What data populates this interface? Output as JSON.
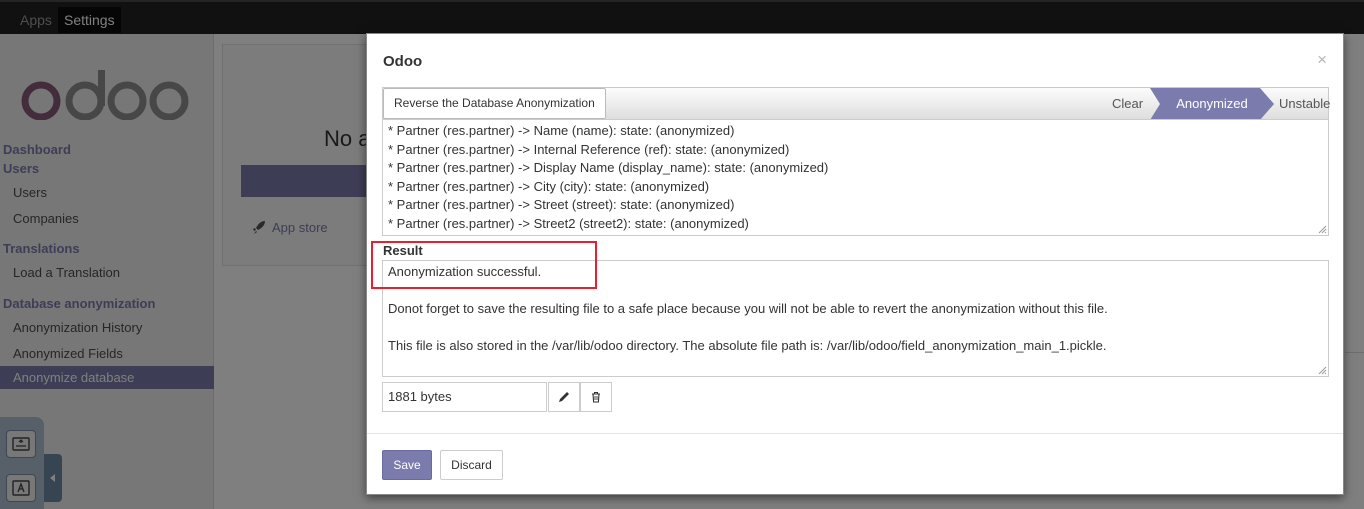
{
  "topnav": {
    "apps": "Apps",
    "settings": "Settings"
  },
  "sidebar": {
    "logo_text": "odoo",
    "sections": [
      {
        "head": "Dashboard"
      },
      {
        "head": "Users",
        "items": [
          "Users",
          "Companies"
        ]
      },
      {
        "head": "Translations",
        "items": [
          "Load a Translation"
        ]
      },
      {
        "head": "Database anonymization",
        "items": [
          "Anonymization History",
          "Anonymized Fields",
          "Anonymize database"
        ]
      }
    ],
    "active_item": "Anonymize database"
  },
  "main": {
    "title_fragment": "No a",
    "app_store": "App store"
  },
  "modal": {
    "title": "Odoo",
    "close": "×",
    "reverse_button": "Reverse the Database Anonymization",
    "states": {
      "clear": "Clear",
      "anonymized": "Anonymized",
      "unstable": "Unstable"
    },
    "active_state": "Anonymized",
    "fields_lines": [
      "* Partner (res.partner) -> Name (name): state: (anonymized)",
      "* Partner (res.partner) -> Internal Reference (ref): state: (anonymized)",
      "* Partner (res.partner) -> Display Name (display_name): state: (anonymized)",
      "* Partner (res.partner) -> City (city): state: (anonymized)",
      "* Partner (res.partner) -> Street (street): state: (anonymized)",
      "* Partner (res.partner) -> Street2 (street2): state: (anonymized)"
    ],
    "result_label": "Result",
    "result_lines": [
      "Anonymization successful.",
      "",
      "Donot forget to save the resulting file to a safe place because you will not be able to revert the anonymization without this file.",
      "",
      "This file is also stored in the /var/lib/odoo directory. The absolute file path is: /var/lib/odoo/field_anonymization_main_1.pickle."
    ],
    "file_size": "1881 bytes",
    "save": "Save",
    "discard": "Discard"
  },
  "colors": {
    "brand": "#7c7bad",
    "highlight_border": "#e8202e",
    "topbar": "#222222"
  }
}
